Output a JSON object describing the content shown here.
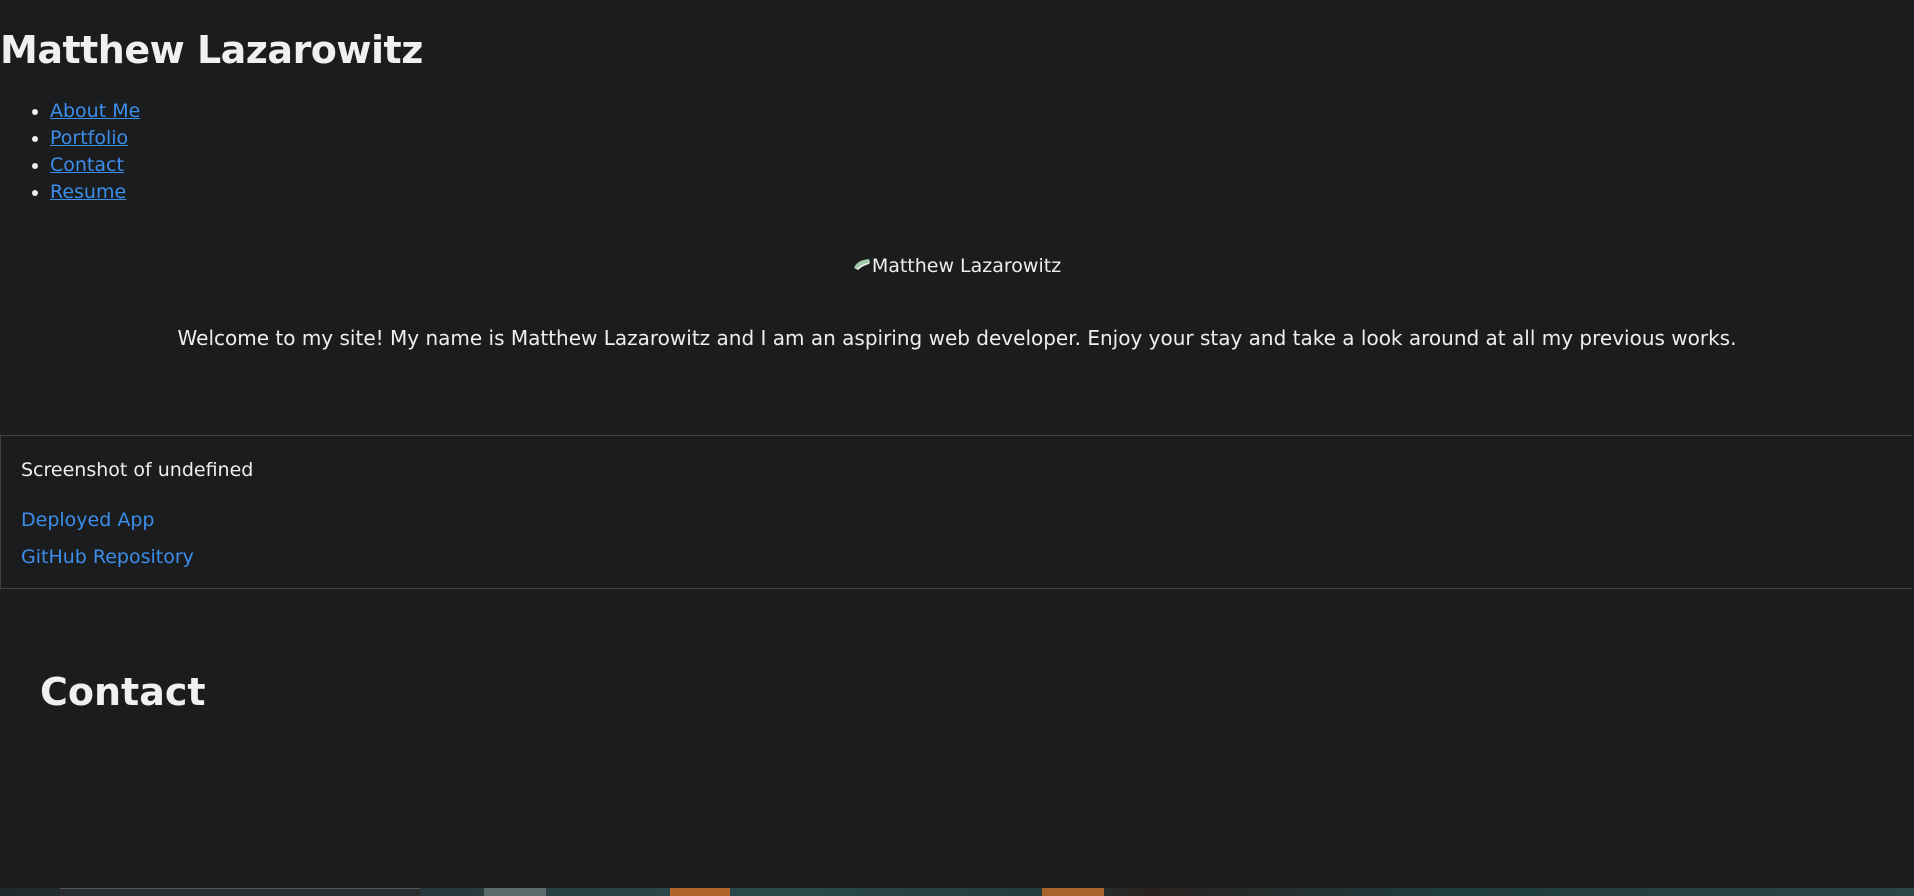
{
  "header": {
    "title": "Matthew Lazarowitz",
    "nav": [
      {
        "label": "About Me"
      },
      {
        "label": "Portfolio"
      },
      {
        "label": "Contact"
      },
      {
        "label": "Resume"
      }
    ]
  },
  "hero": {
    "avatar_alt": "Matthew Lazarowitz",
    "welcome_text": "Welcome to my site! My name is Matthew Lazarowitz and I am an aspiring web developer. Enjoy your stay and take a look around at all my previous works."
  },
  "project": {
    "screenshot_alt": "Screenshot of undefined",
    "deployed_label": "Deployed App",
    "repo_label": "GitHub Repository"
  },
  "contact": {
    "title": "Contact"
  },
  "colors": {
    "background": "#1b1c1e",
    "link": "#3b8eea",
    "text": "#eeeeee",
    "border": "#3d3e41"
  }
}
